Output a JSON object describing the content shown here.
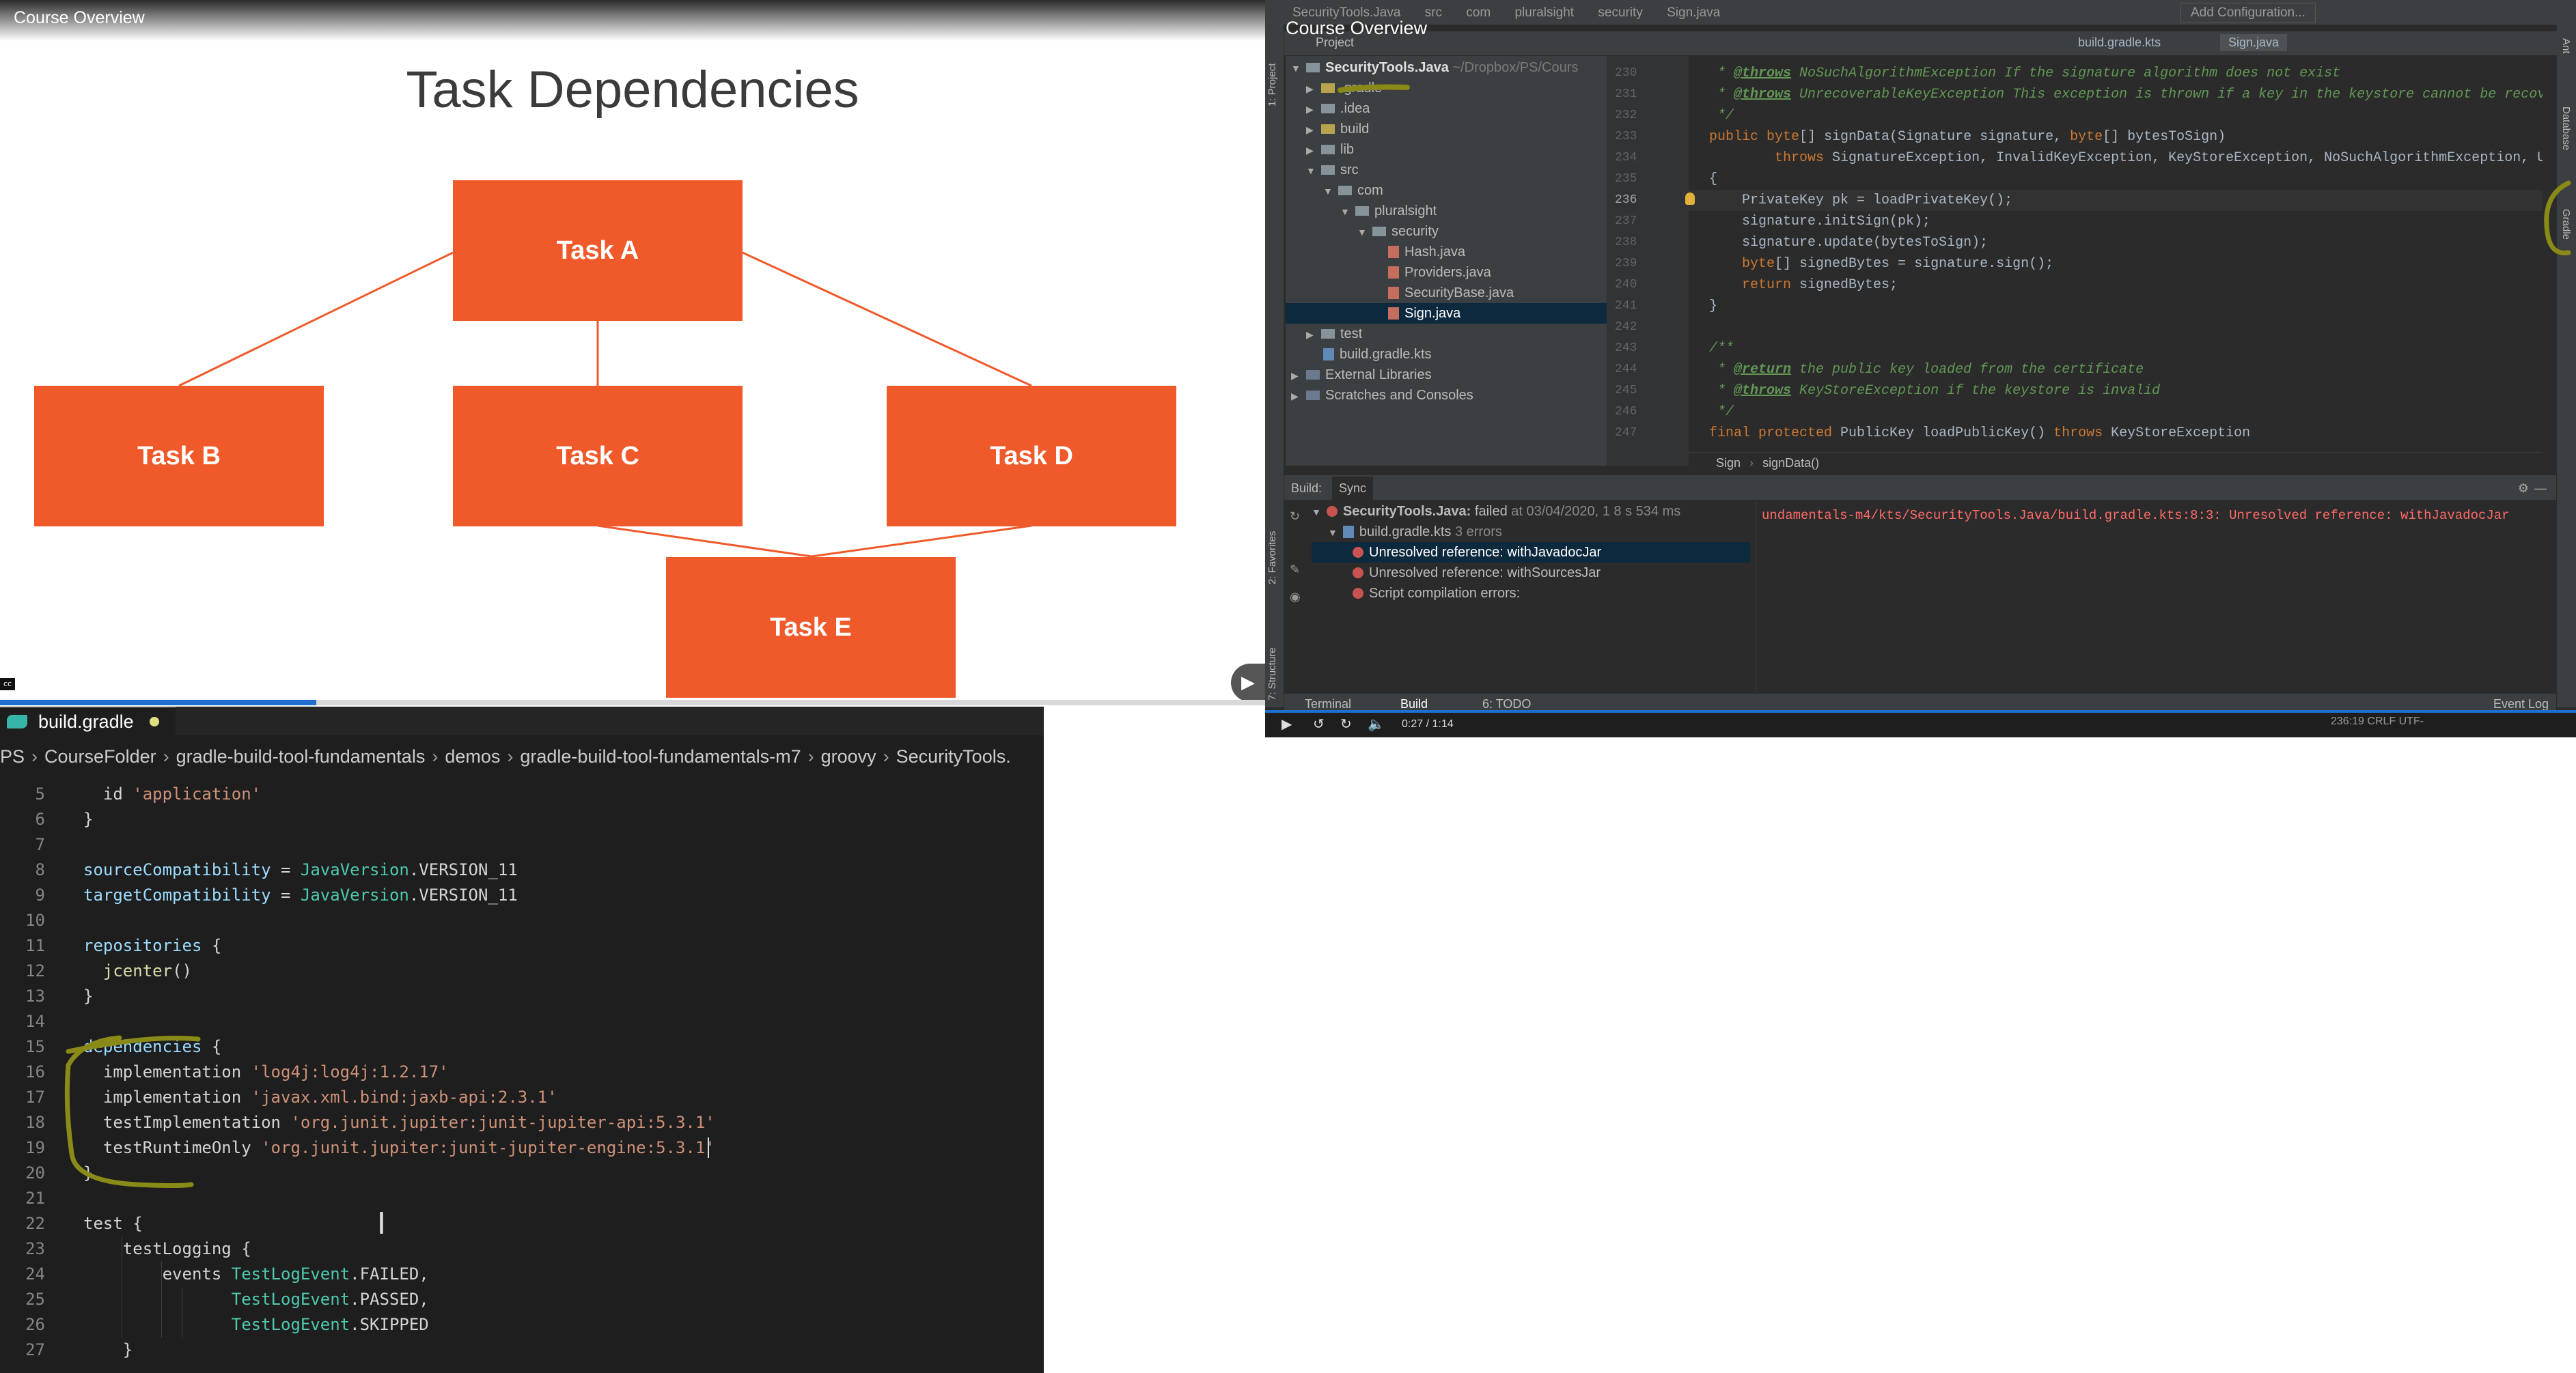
{
  "slide": {
    "video_title": "Course Overview",
    "title": "Task Dependencies",
    "tasks": {
      "a": "Task A",
      "b": "Task B",
      "c": "Task C",
      "d": "Task D",
      "e": "Task E"
    },
    "accent_color": "#f0592a",
    "progress": 0.25
  },
  "ide": {
    "overlay_title": "Course Overview",
    "topbar_crumbs": [
      "SecurityTools.Java",
      "src",
      "com",
      "pluralsight",
      "security",
      "Sign.java"
    ],
    "add_configuration": "Add Configuration...",
    "project_label": "Project",
    "editor_tabs": [
      "build.gradle.kts",
      "Sign.java"
    ],
    "left_strip": [
      "1: Project",
      "2: Favorites",
      "7: Structure"
    ],
    "right_strip": [
      "Ant",
      "Database",
      "Gradle"
    ],
    "tree": {
      "root": "SecurityTools.Java",
      "root_path": "~/Dropbox/PS/Cours",
      "items": [
        ".gradle",
        ".idea",
        "build",
        "lib",
        "src",
        "com",
        "pluralsight",
        "security",
        "Hash.java",
        "Providers.java",
        "SecurityBase.java",
        "Sign.java",
        "test",
        "build.gradle.kts",
        "External Libraries",
        "Scratches and Consoles"
      ]
    },
    "line_numbers": [
      "230",
      "231",
      "232",
      "233",
      "234",
      "235",
      "236",
      "237",
      "238",
      "239",
      "240",
      "241",
      "242",
      "243",
      "244",
      "245",
      "246",
      "247"
    ],
    "code": {
      "l0": "   * ",
      "l0_tag": "@throws",
      "l0_rest": " NoSuchAlgorithmException If the signature algorithm does not exist",
      "l1": "   * ",
      "l1_tag": "@throws",
      "l1_rest": " UnrecoverableKeyException This exception is thrown if a key in the keystore cannot be recover",
      "l2": "   */",
      "l3_kw": "  public byte",
      "l3_rest": "[] signData(Signature signature, ",
      "l3_kw2": "byte",
      "l3_rest2": "[] bytesToSign)",
      "l4_kw": "          throws",
      "l4_rest": " SignatureException, InvalidKeyException, KeyStoreException, NoSuchAlgorithmException, Unr",
      "l5": "  {",
      "l6": "      PrivateKey pk = loadPrivateKey();",
      "l7": "      signature.initSign(pk);",
      "l8": "      signature.update(bytesToSign);",
      "l9_kw": "      byte",
      "l9_rest": "[] signedBytes = signature.sign();",
      "l10_kw": "      return",
      "l10_rest": " signedBytes;",
      "l11": "  }",
      "l12": "",
      "l13": "  /**",
      "l14": "   * ",
      "l14_tag": "@return",
      "l14_rest": " the public key loaded from the certificate",
      "l15": "   * ",
      "l15_tag": "@throws",
      "l15_rest": " KeyStoreException if the keystore is invalid",
      "l16": "   */",
      "l17_kw": "  final protected",
      "l17_rest": " PublicKey loadPublicKey() ",
      "l17_kw2": "throws",
      "l17_rest2": " KeyStoreException"
    },
    "editor_breadcrumbs": [
      "Sign",
      "signData()"
    ],
    "build": {
      "label": "Build:",
      "sync_tab": "Sync",
      "failed_name": "SecurityTools.Java:",
      "failed_text": " failed",
      "failed_time": " at 03/04/2020, 1 8 s 534 ms",
      "gradle_file": "build.gradle.kts",
      "error_count": "3 errors",
      "errors": [
        "Unresolved reference: withJavadocJar",
        "Unresolved reference: withSourcesJar",
        "Script compilation errors:"
      ],
      "output": "undamentals-m4/kts/SecurityTools.Java/build.gradle.kts:8:3: Unresolved reference: withJavadocJar"
    },
    "bottom_tabs": {
      "terminal": "Terminal",
      "build": "Build",
      "todo": "6: TODO",
      "event_log": "Event Log"
    },
    "video_time": "0:27 / 1:14",
    "status": "236:19   CRLF   UTF-"
  },
  "vscode": {
    "tab_label": "build.gradle",
    "breadcrumbs": [
      "PS",
      "CourseFolder",
      "gradle-build-tool-fundamentals",
      "demos",
      "gradle-build-tool-fundamentals-m7",
      "groovy",
      "SecurityTools."
    ],
    "line_numbers": [
      "5",
      "6",
      "7",
      "8",
      "9",
      "10",
      "11",
      "12",
      "13",
      "14",
      "15",
      "16",
      "17",
      "18",
      "19",
      "20",
      "21",
      "22",
      "23",
      "24",
      "25",
      "26",
      "27"
    ],
    "code": {
      "l5a": "  id ",
      "l5b": "'application'",
      "l6": "}",
      "l8a": "sourceCompatibility",
      "l8b": " = ",
      "l8c": "JavaVersion",
      "l8d": ".VERSION_11",
      "l9a": "targetCompatibility",
      "l9b": " = ",
      "l9c": "JavaVersion",
      "l9d": ".VERSION_11",
      "l11a": "repositories",
      "l11b": " {",
      "l12a": "  ",
      "l12b": "jcenter",
      "l12c": "()",
      "l13": "}",
      "l15a": "dependencies",
      "l15b": " {",
      "l16a": "  implementation ",
      "l16b": "'log4j:log4j:1.2.17'",
      "l17a": "  implementation ",
      "l17b": "'javax.xml.bind:jaxb-api:2.3.1'",
      "l18a": "  testImplementation ",
      "l18b": "'org.junit.jupiter:junit-jupiter-api:5.3.1'",
      "l19a": "  testRuntimeOnly ",
      "l19b": "'org.junit.jupiter:junit-jupiter-engine:5.3.1'",
      "l20": "}",
      "l22": "test {",
      "l23": "    testLogging {",
      "l24a": "        events ",
      "l24b": "TestLogEvent",
      "l24c": ".FAILED,",
      "l25a": "               ",
      "l25b": "TestLogEvent",
      "l25c": ".PASSED,",
      "l26a": "               ",
      "l26b": "TestLogEvent",
      "l26c": ".SKIPPED",
      "l27": "    }"
    }
  },
  "annotation_color": "#8a8a18"
}
